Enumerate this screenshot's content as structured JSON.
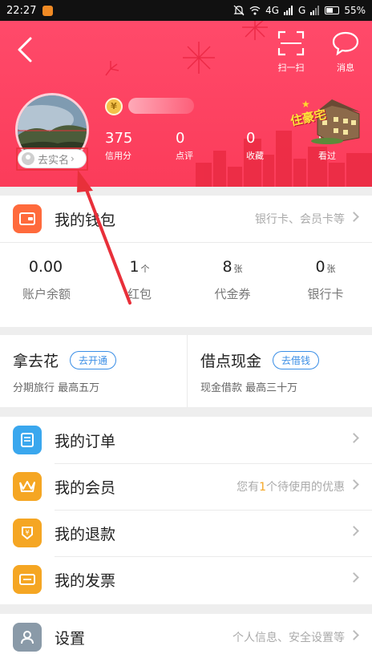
{
  "status_bar": {
    "time": "22:27",
    "network": "4G",
    "network2": "G",
    "battery": "55%"
  },
  "header": {
    "scan_label": "扫一扫",
    "message_label": "消息",
    "verify_label": "去实名",
    "badge_text": "住豪宅",
    "medal_text": "¥",
    "stats": [
      {
        "value": "375",
        "label": "信用分"
      },
      {
        "value": "0",
        "label": "点评"
      },
      {
        "value": "0",
        "label": "收藏"
      },
      {
        "value": "0",
        "label": "看过"
      }
    ]
  },
  "wallet": {
    "title": "我的钱包",
    "hint": "银行卡、会员卡等",
    "items": [
      {
        "value": "0.00",
        "unit": "",
        "label": "账户余额"
      },
      {
        "value": "1",
        "unit": "个",
        "label": "红包"
      },
      {
        "value": "8",
        "unit": "张",
        "label": "代金券"
      },
      {
        "value": "0",
        "unit": "张",
        "label": "银行卡"
      }
    ]
  },
  "loans": [
    {
      "title": "拿去花",
      "button": "去开通",
      "subtitle": "分期旅行 最高五万"
    },
    {
      "title": "借点现金",
      "button": "去借钱",
      "subtitle": "现金借款 最高三十万"
    }
  ],
  "menu": {
    "orders": {
      "label": "我的订单"
    },
    "membership": {
      "label": "我的会员",
      "hint_pre": "您有",
      "hint_num": "1",
      "hint_post": "个待使用的优惠"
    },
    "refund": {
      "label": "我的退款"
    },
    "invoice": {
      "label": "我的发票"
    },
    "settings": {
      "label": "设置",
      "hint": "个人信息、安全设置等"
    }
  },
  "colors": {
    "header_red": "#fb3c5a",
    "wallet_icon": "#ff6a3c",
    "orders_icon": "#3aa7ee",
    "member_icon": "#f5a623",
    "refund_icon": "#f5a623",
    "invoice_icon": "#f5a623",
    "settings_icon": "#8a9aa8",
    "annotation": "#e8303a"
  }
}
